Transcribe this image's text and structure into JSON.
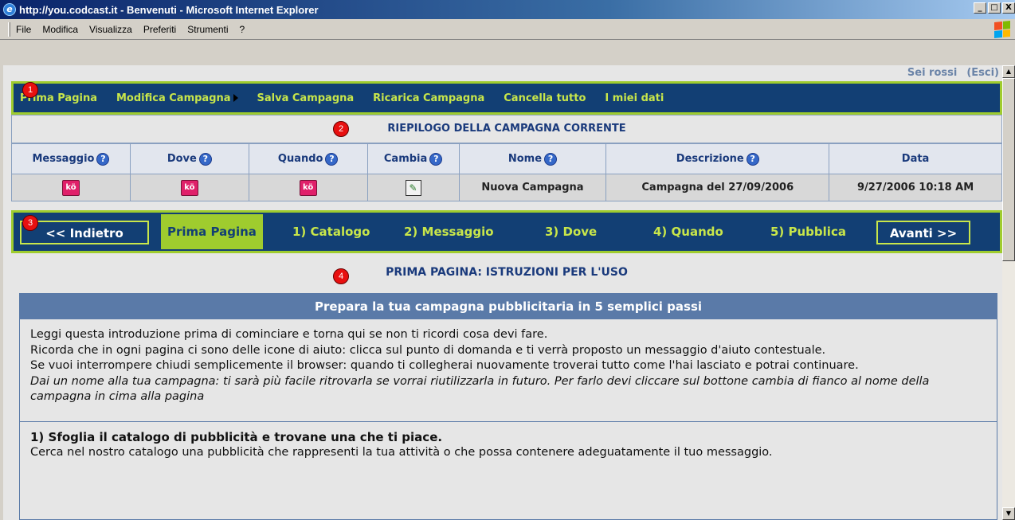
{
  "window": {
    "title": "http://you.codcast.it - Benvenuti - Microsoft Internet Explorer",
    "min": "_",
    "max": "□",
    "close": "X"
  },
  "menu": [
    "File",
    "Modifica",
    "Visualizza",
    "Preferiti",
    "Strumenti",
    "?"
  ],
  "user": {
    "name": "Sei rossi",
    "logout": "(Esci)"
  },
  "nav1": [
    "Prima Pagina",
    "Modifica Campagna",
    "Salva Campagna",
    "Ricarica Campagna",
    "Cancella tutto",
    "I miei dati"
  ],
  "summary": {
    "title": "RIEPILOGO DELLA CAMPAGNA CORRENTE",
    "headers": [
      "Messaggio",
      "Dove",
      "Quando",
      "Cambia",
      "Nome",
      "Descrizione",
      "Data"
    ],
    "ko_label": "kö",
    "nome": "Nuova Campagna",
    "descrizione": "Campagna del 27/09/2006",
    "data": "9/27/2006 10:18 AM"
  },
  "nav2": {
    "back": "<< Indietro",
    "active": "Prima Pagina",
    "steps": [
      "1) Catalogo",
      "2) Messaggio",
      "3) Dove",
      "4) Quando",
      "5) Pubblica"
    ],
    "next": "Avanti >>"
  },
  "instructions": {
    "title": "PRIMA PAGINA: ISTRUZIONI PER L'USO",
    "panel_title": "Prepara la tua campagna pubblicitaria in 5 semplici passi",
    "p1": "Leggi questa introduzione prima di cominciare e torna qui se non ti ricordi cosa devi fare.",
    "p2": "Ricorda che in ogni pagina ci sono delle icone di aiuto: clicca sul punto di domanda e ti verrà proposto un messaggio d'aiuto contestuale.",
    "p3": "Se vuoi interrompere chiudi semplicemente il browser: quando ti collegherai nuovamente troverai tutto come l'hai lasciato e potrai continuare.",
    "p4": "Dai un nome alla tua campagna: ti sarà più facile ritrovarla se vorrai riutilizzarla in futuro. Per farlo devi cliccare sul bottone cambia di fianco al nome della campagna in cima alla pagina",
    "step1_title": "1) Sfoglia il catalogo di pubblicità e trovane una che ti piace.",
    "step1_text": "Cerca nel nostro catalogo una pubblicità che rappresenti la tua attività o che possa contenere adeguatamente il tuo messaggio."
  },
  "markers": [
    "1",
    "2",
    "3",
    "4"
  ],
  "colors": {
    "nav_bg": "#123f74",
    "nav_border": "#9fcc2e",
    "nav_text": "#c8e64a",
    "panel_head": "#5a7aa8"
  }
}
